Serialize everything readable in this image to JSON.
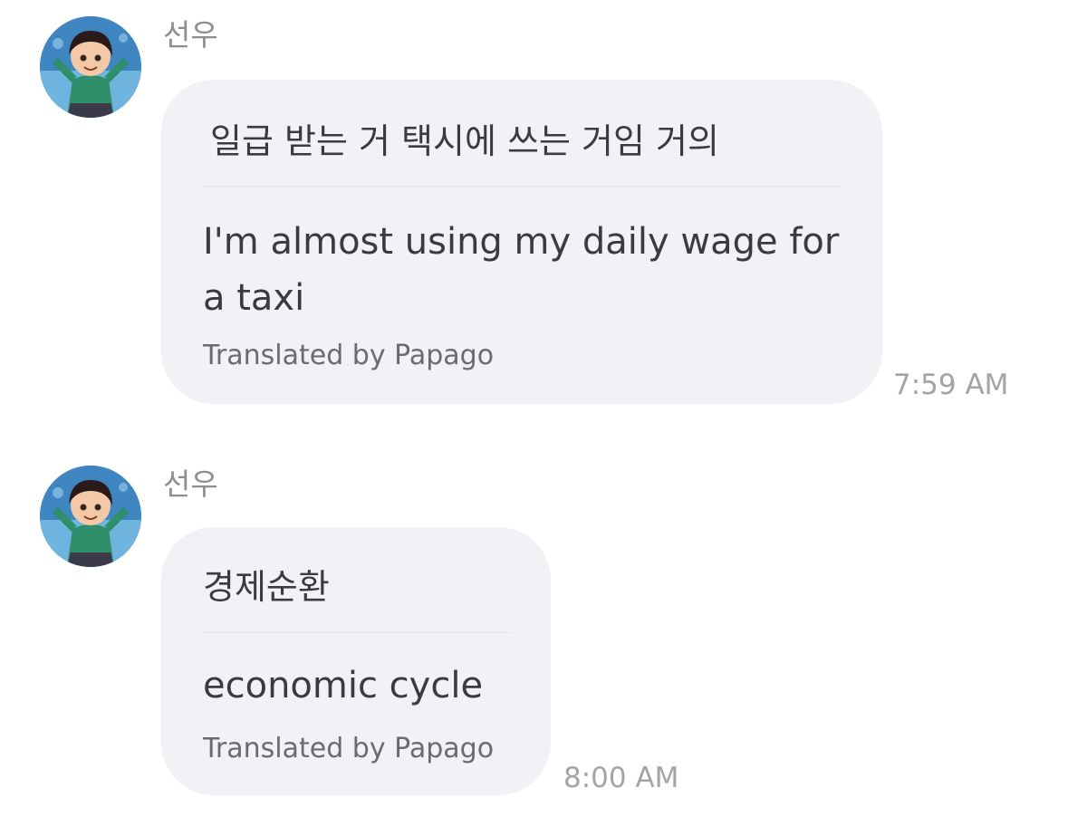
{
  "messages": [
    {
      "sender": "선우",
      "original": "일급 받는 거 택시에 쓰는 거임 거의",
      "translation": "I'm almost using my daily wage for a taxi",
      "credit": "Translated by Papago",
      "time": "7:59 AM",
      "avatar_icon": "cartoon-girl-avatar"
    },
    {
      "sender": "선우",
      "original": "경제순환",
      "translation": "economic cycle",
      "credit": "Translated by Papago",
      "time": "8:00 AM",
      "avatar_icon": "cartoon-girl-avatar"
    }
  ],
  "colors": {
    "bubble": "#f2f2f6",
    "text": "#3a3a3f",
    "muted": "#8e8e93",
    "time": "#a3a3a8"
  }
}
